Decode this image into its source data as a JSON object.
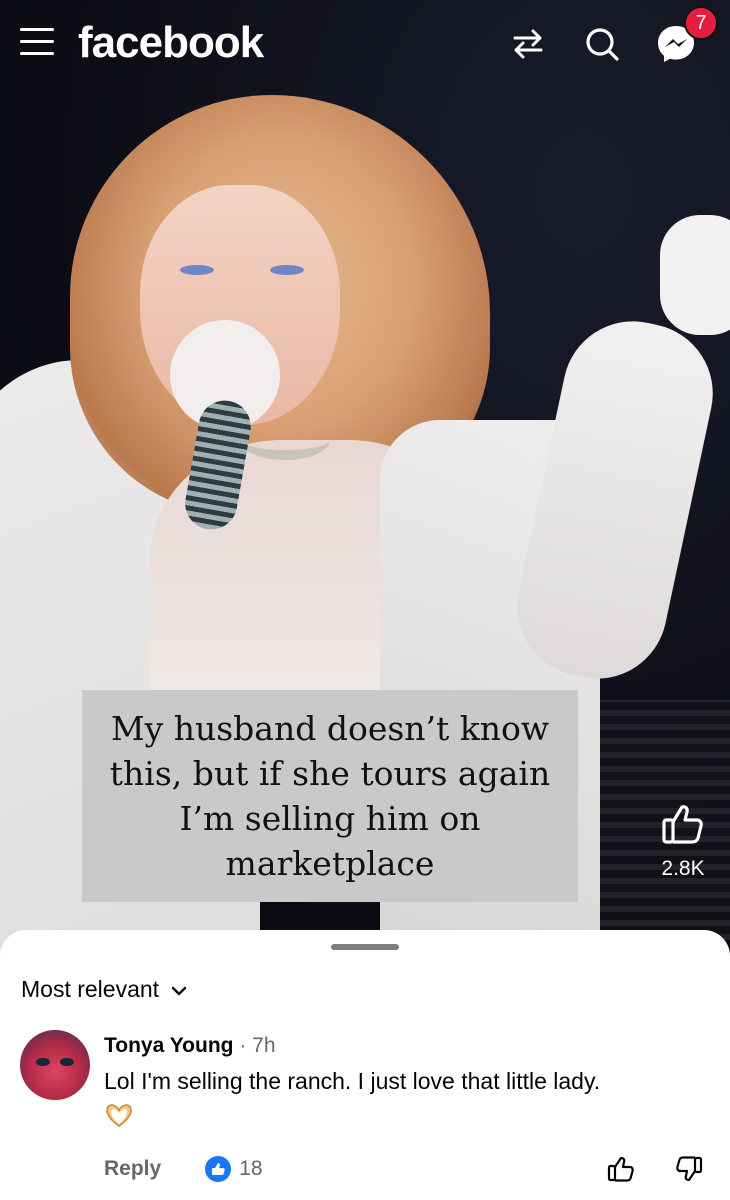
{
  "header": {
    "brand": "facebook",
    "notification_count": "7"
  },
  "video": {
    "caption": "My husband doesn’t know this, but if she tours again I’m selling him on marketplace",
    "like_count": "2.8K"
  },
  "comments": {
    "sort_label": "Most relevant",
    "items": [
      {
        "author": "Tonya Young",
        "time": "7h",
        "text": "Lol I'm selling the ranch. I just love that little lady.",
        "reply_label": "Reply",
        "reaction_count": "18"
      }
    ]
  },
  "colors": {
    "brand": "#ffffff",
    "accent": "#1877f2",
    "badge": "#e41e3f"
  }
}
